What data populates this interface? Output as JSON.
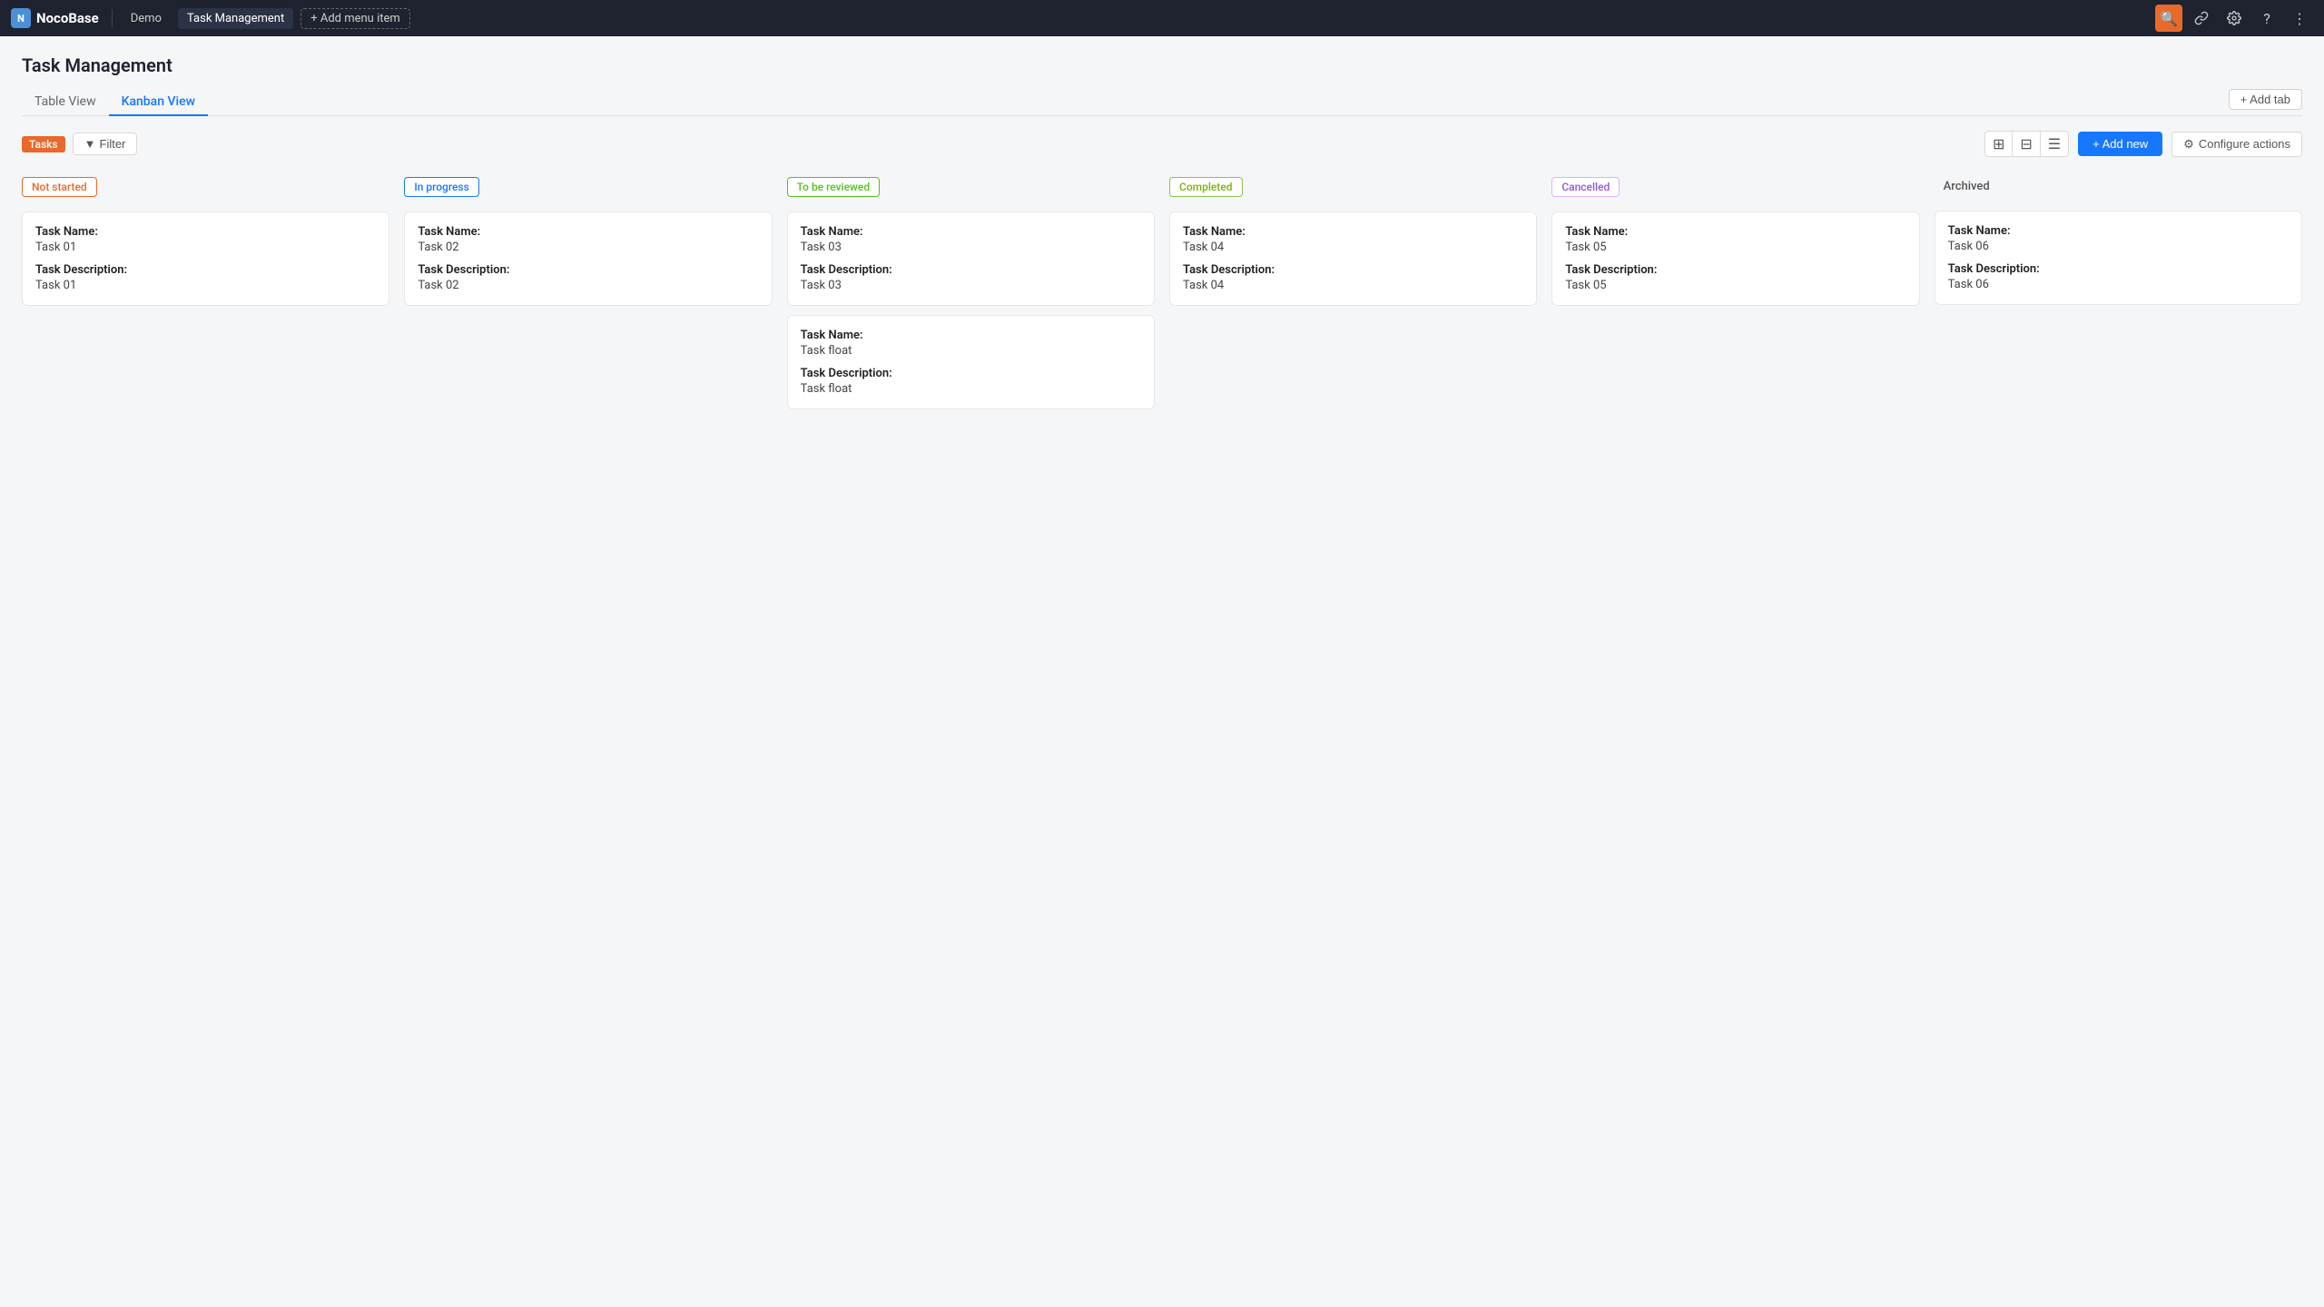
{
  "brand": {
    "icon_text": "N",
    "name": "NocoBase"
  },
  "topnav": {
    "items": [
      {
        "id": "demo",
        "label": "Demo",
        "active": false
      },
      {
        "id": "task-management",
        "label": "Task Management",
        "active": true
      }
    ],
    "add_menu_label": "+ Add menu item",
    "icons": [
      {
        "id": "search",
        "symbol": "🔍",
        "active": true
      },
      {
        "id": "link",
        "symbol": "🔗",
        "active": false
      },
      {
        "id": "settings",
        "symbol": "⚙",
        "active": false
      },
      {
        "id": "help",
        "symbol": "?",
        "active": false
      },
      {
        "id": "more",
        "symbol": "⋮",
        "active": false
      }
    ]
  },
  "page": {
    "title": "Task Management"
  },
  "tabs": [
    {
      "id": "table-view",
      "label": "Table View",
      "active": false
    },
    {
      "id": "kanban-view",
      "label": "Kanban View",
      "active": true
    }
  ],
  "add_tab_label": "+ Add tab",
  "toolbar": {
    "tasks_badge": "Tasks",
    "filter_label": "Filter",
    "add_new_label": "+ Add new",
    "configure_actions_label": "Configure actions"
  },
  "columns": [
    {
      "id": "not-started",
      "badge_class": "badge-not-started",
      "label": "Not started",
      "cards": [
        {
          "task_name_label": "Task Name:",
          "task_name_value": "Task 01",
          "task_desc_label": "Task Description:",
          "task_desc_value": "Task 01"
        }
      ]
    },
    {
      "id": "in-progress",
      "badge_class": "badge-in-progress",
      "label": "In progress",
      "cards": [
        {
          "task_name_label": "Task Name:",
          "task_name_value": "Task 02",
          "task_desc_label": "Task Description:",
          "task_desc_value": "Task 02"
        }
      ]
    },
    {
      "id": "to-be-reviewed",
      "badge_class": "badge-to-be-reviewed",
      "label": "To be reviewed",
      "cards": [
        {
          "task_name_label": "Task Name:",
          "task_name_value": "Task 03",
          "task_desc_label": "Task Description:",
          "task_desc_value": "Task 03"
        },
        {
          "task_name_label": "Task Name:",
          "task_name_value": "Task float",
          "task_desc_label": "Task Description:",
          "task_desc_value": "Task float"
        }
      ]
    },
    {
      "id": "completed",
      "badge_class": "badge-completed",
      "label": "Completed",
      "cards": [
        {
          "task_name_label": "Task Name:",
          "task_name_value": "Task 04",
          "task_desc_label": "Task Description:",
          "task_desc_value": "Task 04"
        }
      ]
    },
    {
      "id": "cancelled",
      "badge_class": "badge-cancelled",
      "label": "Cancelled",
      "cards": [
        {
          "task_name_label": "Task Name:",
          "task_name_value": "Task 05",
          "task_desc_label": "Task Description:",
          "task_desc_value": "Task 05"
        }
      ]
    },
    {
      "id": "archived",
      "badge_class": "badge-archived",
      "label": "Archived",
      "cards": [
        {
          "task_name_label": "Task Name:",
          "task_name_value": "Task 06",
          "task_desc_label": "Task Description:",
          "task_desc_value": "Task 06"
        }
      ]
    }
  ]
}
